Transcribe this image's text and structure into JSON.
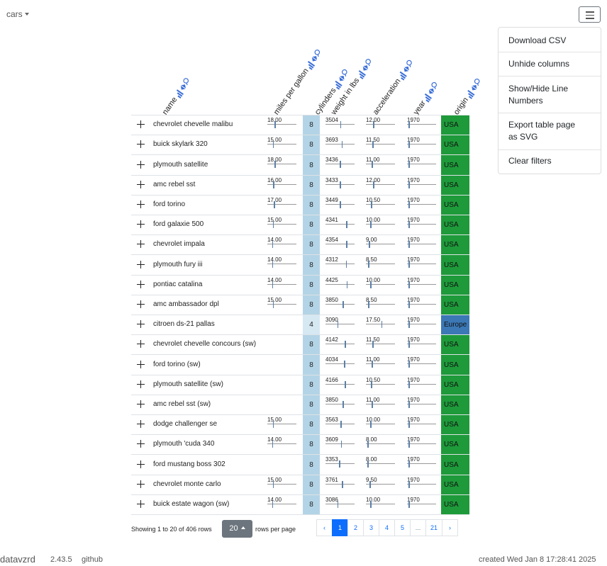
{
  "app": {
    "dataset_label": "cars"
  },
  "menu": {
    "items": [
      "Download CSV",
      "Unhide columns",
      "Show/Hide Line Numbers",
      "Export table page as SVG",
      "Clear filters"
    ]
  },
  "columns": [
    "name",
    "miles per gallon",
    "cylinders",
    "weight in lbs",
    "acceleration",
    "year",
    "origin"
  ],
  "rows": [
    {
      "name": "chevrolet chevelle malibu",
      "mpg": "18.00",
      "cylinders": "8",
      "weight": "3504",
      "acceleration": "12.00",
      "year": "1970",
      "origin": "USA"
    },
    {
      "name": "buick skylark 320",
      "mpg": "15.00",
      "cylinders": "8",
      "weight": "3693",
      "acceleration": "11.50",
      "year": "1970",
      "origin": "USA"
    },
    {
      "name": "plymouth satellite",
      "mpg": "18.00",
      "cylinders": "8",
      "weight": "3436",
      "acceleration": "11.00",
      "year": "1970",
      "origin": "USA"
    },
    {
      "name": "amc rebel sst",
      "mpg": "16.00",
      "cylinders": "8",
      "weight": "3433",
      "acceleration": "12.00",
      "year": "1970",
      "origin": "USA"
    },
    {
      "name": "ford torino",
      "mpg": "17.00",
      "cylinders": "8",
      "weight": "3449",
      "acceleration": "10.50",
      "year": "1970",
      "origin": "USA"
    },
    {
      "name": "ford galaxie 500",
      "mpg": "15.00",
      "cylinders": "8",
      "weight": "4341",
      "acceleration": "10.00",
      "year": "1970",
      "origin": "USA"
    },
    {
      "name": "chevrolet impala",
      "mpg": "14.00",
      "cylinders": "8",
      "weight": "4354",
      "acceleration": "9.00",
      "year": "1970",
      "origin": "USA"
    },
    {
      "name": "plymouth fury iii",
      "mpg": "14.00",
      "cylinders": "8",
      "weight": "4312",
      "acceleration": "8.50",
      "year": "1970",
      "origin": "USA"
    },
    {
      "name": "pontiac catalina",
      "mpg": "14.00",
      "cylinders": "8",
      "weight": "4425",
      "acceleration": "10.00",
      "year": "1970",
      "origin": "USA"
    },
    {
      "name": "amc ambassador dpl",
      "mpg": "15.00",
      "cylinders": "8",
      "weight": "3850",
      "acceleration": "8.50",
      "year": "1970",
      "origin": "USA"
    },
    {
      "name": "citroen ds-21 pallas",
      "mpg": "",
      "cylinders": "4",
      "weight": "3090",
      "acceleration": "17.50",
      "year": "1970",
      "origin": "Europe"
    },
    {
      "name": "chevrolet chevelle concours (sw)",
      "mpg": "",
      "cylinders": "8",
      "weight": "4142",
      "acceleration": "11.50",
      "year": "1970",
      "origin": "USA"
    },
    {
      "name": "ford torino (sw)",
      "mpg": "",
      "cylinders": "8",
      "weight": "4034",
      "acceleration": "11.00",
      "year": "1970",
      "origin": "USA"
    },
    {
      "name": "plymouth satellite (sw)",
      "mpg": "",
      "cylinders": "8",
      "weight": "4166",
      "acceleration": "10.50",
      "year": "1970",
      "origin": "USA"
    },
    {
      "name": "amc rebel sst (sw)",
      "mpg": "",
      "cylinders": "8",
      "weight": "3850",
      "acceleration": "11.00",
      "year": "1970",
      "origin": "USA"
    },
    {
      "name": "dodge challenger se",
      "mpg": "15.00",
      "cylinders": "8",
      "weight": "3563",
      "acceleration": "10.00",
      "year": "1970",
      "origin": "USA"
    },
    {
      "name": "plymouth 'cuda 340",
      "mpg": "14.00",
      "cylinders": "8",
      "weight": "3609",
      "acceleration": "8.00",
      "year": "1970",
      "origin": "USA"
    },
    {
      "name": "ford mustang boss 302",
      "mpg": "",
      "cylinders": "8",
      "weight": "3353",
      "acceleration": "8.00",
      "year": "1970",
      "origin": "USA"
    },
    {
      "name": "chevrolet monte carlo",
      "mpg": "15.00",
      "cylinders": "8",
      "weight": "3761",
      "acceleration": "9.50",
      "year": "1970",
      "origin": "USA"
    },
    {
      "name": "buick estate wagon (sw)",
      "mpg": "14.00",
      "cylinders": "8",
      "weight": "3086",
      "acceleration": "10.00",
      "year": "1970",
      "origin": "USA"
    }
  ],
  "colors": {
    "usa": "#1e9a3a",
    "europe": "#3b78b5",
    "cyl8": "#b3d4e6",
    "cyl4": "#d6e8f2",
    "accent": "#0d6efd"
  },
  "pagination": {
    "showing_text": "Showing 1 to 20 of 406 rows",
    "rows_per_page_value": "20",
    "rows_per_page_label": "rows per page",
    "pages": [
      "‹",
      "1",
      "2",
      "3",
      "4",
      "5",
      "...",
      "21",
      "›"
    ],
    "active_page": "1"
  },
  "footer": {
    "brand": "datavzrd",
    "version": "2.43.5",
    "link": "github",
    "created": "created Wed Jan 8 17:28:41 2025"
  }
}
